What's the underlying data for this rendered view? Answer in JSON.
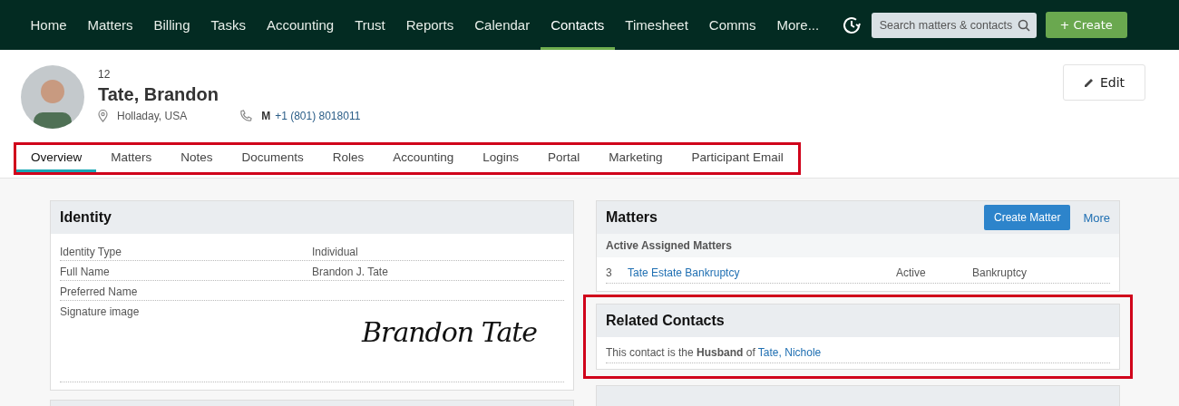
{
  "nav": {
    "items": [
      {
        "label": "Home",
        "selected": false
      },
      {
        "label": "Matters",
        "selected": false
      },
      {
        "label": "Billing",
        "selected": false
      },
      {
        "label": "Tasks",
        "selected": false
      },
      {
        "label": "Accounting",
        "selected": false
      },
      {
        "label": "Trust",
        "selected": false
      },
      {
        "label": "Reports",
        "selected": false
      },
      {
        "label": "Calendar",
        "selected": false
      },
      {
        "label": "Contacts",
        "selected": true
      },
      {
        "label": "Timesheet",
        "selected": false
      },
      {
        "label": "Comms",
        "selected": false
      },
      {
        "label": "More...",
        "selected": false
      }
    ],
    "search": {
      "placeholder": "Search matters & contacts"
    },
    "create_button": "+ Create"
  },
  "contact": {
    "number": "12",
    "name": "Tate, Brandon",
    "location": "Holladay, USA",
    "phone_type": "M",
    "phone": "+1 (801) 8018011",
    "edit_button": "Edit"
  },
  "tabs": {
    "highlighted": true,
    "items": [
      {
        "label": "Overview",
        "selected": true
      },
      {
        "label": "Matters",
        "selected": false
      },
      {
        "label": "Notes",
        "selected": false
      },
      {
        "label": "Documents",
        "selected": false
      },
      {
        "label": "Roles",
        "selected": false
      },
      {
        "label": "Accounting",
        "selected": false
      },
      {
        "label": "Logins",
        "selected": false
      },
      {
        "label": "Portal",
        "selected": false
      },
      {
        "label": "Marketing",
        "selected": false
      },
      {
        "label": "Participant Email",
        "selected": false
      }
    ]
  },
  "identity": {
    "title": "Identity",
    "rows": [
      {
        "label": "Identity Type",
        "value": "Individual"
      },
      {
        "label": "Full Name",
        "value": "Brandon J. Tate"
      },
      {
        "label": "Preferred Name"
      },
      {
        "label": "Signature image",
        "signature": "Brandon Tate"
      }
    ]
  },
  "matters": {
    "title": "Matters",
    "create_button": "Create Matter",
    "more_link": "More",
    "subheading": "Active Assigned Matters",
    "rows": [
      {
        "number": "3",
        "name": "Tate Estate Bankruptcy",
        "status": "Active",
        "type": "Bankruptcy"
      }
    ]
  },
  "related_contacts": {
    "title": "Related Contacts",
    "highlighted": true,
    "text": "This contact is the **Husband** of",
    "link": "Tate, Nichole"
  }
}
